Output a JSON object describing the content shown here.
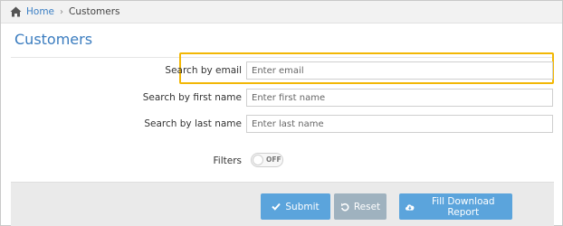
{
  "breadcrumb": {
    "home": "Home",
    "separator": "›",
    "current": "Customers"
  },
  "page": {
    "title": "Customers"
  },
  "form": {
    "email": {
      "label": "Search by email",
      "placeholder": "Enter email",
      "value": ""
    },
    "first_name": {
      "label": "Search by first name",
      "placeholder": "Enter first name",
      "value": ""
    },
    "last_name": {
      "label": "Search by last name",
      "placeholder": "Enter last name",
      "value": ""
    },
    "filters": {
      "label": "Filters",
      "toggle_state": "OFF"
    }
  },
  "actions": {
    "submit": "Submit",
    "reset": "Reset",
    "report": "Fill Download Report"
  },
  "colors": {
    "accent": "#3a7cbf",
    "button_primary": "#5ba4dc",
    "button_reset": "#9fb2bf",
    "highlight": "#f2b705"
  },
  "icons": {
    "home": "home-icon",
    "submit": "check-icon",
    "reset": "undo-icon",
    "report": "cloud-download-icon"
  }
}
